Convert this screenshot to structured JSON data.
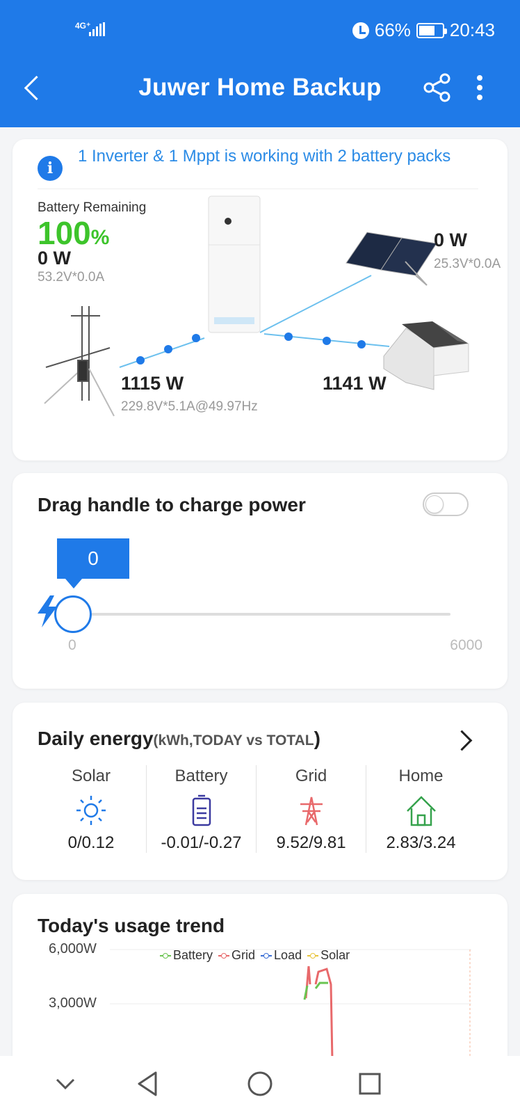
{
  "status_bar": {
    "network": "4G⁺",
    "battery_percent": "66%",
    "time": "20:43"
  },
  "app_bar": {
    "title": "Juwer Home Backup",
    "icons": [
      "back-arrow-icon",
      "share-icon",
      "more-vert-icon"
    ]
  },
  "flow": {
    "info": "1 Inverter & 1 Mppt is working with 2 battery packs",
    "battery": {
      "label": "Battery Remaining",
      "percent_value": "100",
      "percent_sign": "%",
      "power": "0 W",
      "detail": "53.2V*0.0A"
    },
    "solar": {
      "power": "0 W",
      "detail": "25.3V*0.0A"
    },
    "grid": {
      "power": "1115 W",
      "detail": "229.8V*5.1A@49.97Hz"
    },
    "home": {
      "power": "1141 W"
    },
    "colors": {
      "accent": "#1f7ae8",
      "battery_green": "#3dc42b",
      "line": "#6cc0ee"
    }
  },
  "charge": {
    "title": "Drag handle to charge power",
    "toggle_on": false,
    "value": "0",
    "min": "0",
    "max": "6000",
    "fraction": 0
  },
  "daily": {
    "title": "Daily energy",
    "subtitle": "(kWh,TODAY vs TOTAL",
    "subtitle_close": ")",
    "columns": [
      {
        "label": "Solar",
        "icon": "sun-icon",
        "value": "0/0.12",
        "color": "#1f7ae8"
      },
      {
        "label": "Battery",
        "icon": "battery-icon",
        "value": "-0.01/-0.27",
        "color": "#3b3aa0"
      },
      {
        "label": "Grid",
        "icon": "power-tower-icon",
        "value": "9.52/9.81",
        "color": "#e8696b"
      },
      {
        "label": "Home",
        "icon": "home-icon",
        "value": "2.83/3.24",
        "color": "#35a24c"
      }
    ]
  },
  "trend": {
    "title": "Today's usage trend",
    "legend": [
      {
        "name": "Battery",
        "color": "#6ac451"
      },
      {
        "name": "Grid",
        "color": "#e8696b"
      },
      {
        "name": "Load",
        "color": "#3b6fd6"
      },
      {
        "name": "Solar",
        "color": "#e8c43b"
      }
    ],
    "y_ticks": [
      "6,000W",
      "3,000W"
    ]
  },
  "nav": [
    "collapse-icon",
    "back-icon",
    "home-circle-icon",
    "recents-icon"
  ]
}
